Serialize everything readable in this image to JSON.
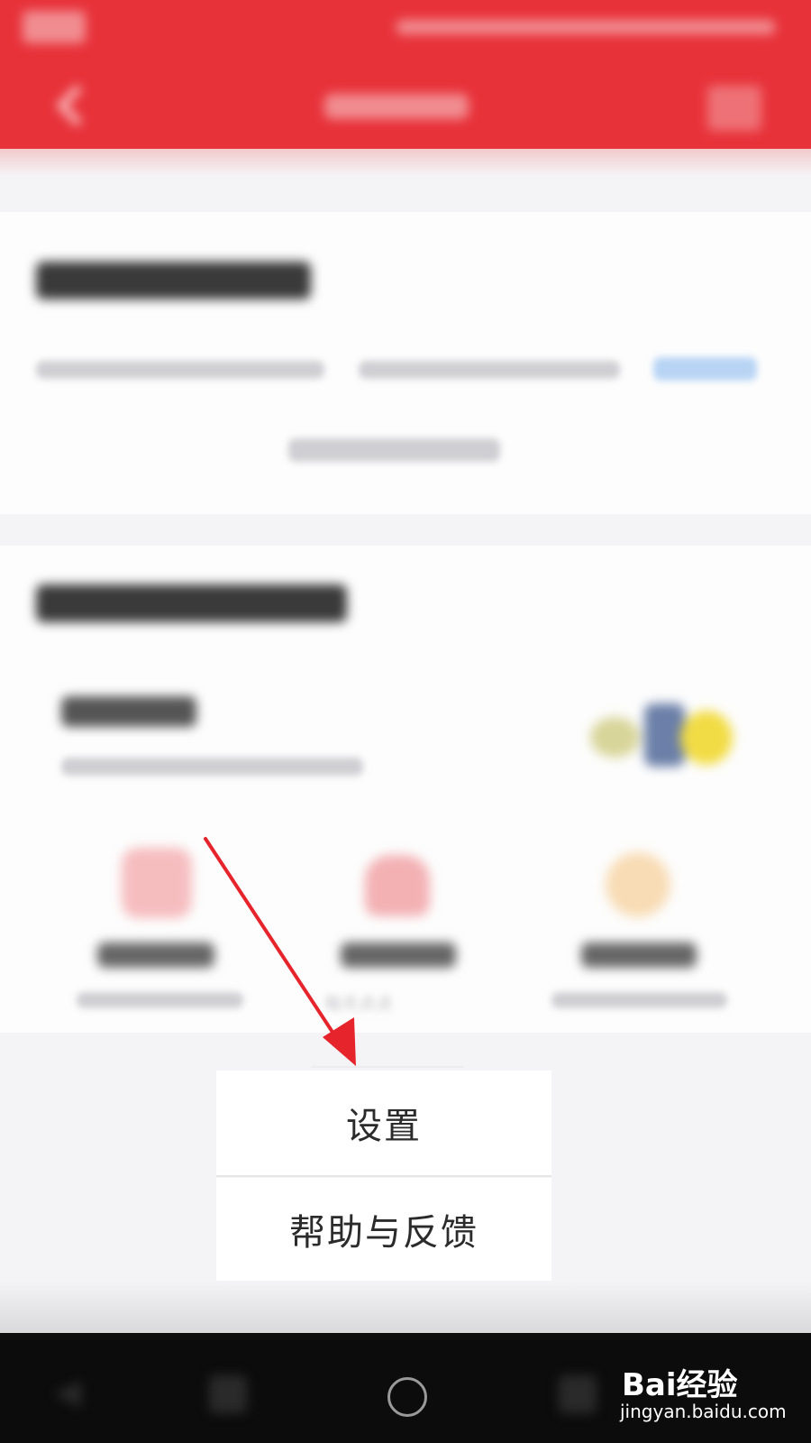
{
  "menu": {
    "items": [
      {
        "label": "设置"
      },
      {
        "label": "帮助与反馈"
      }
    ]
  },
  "partial_text": "每天点点",
  "watermark": {
    "brand": "Bai经验",
    "url": "jingyan.baidu.com"
  },
  "colors": {
    "header_bg": "#e8323a",
    "arrow": "#e6242b",
    "menu_bg": "#ffffff",
    "navbar_bg": "#0c0c0c"
  },
  "icons": {
    "back": "back-arrow-icon",
    "more": "more-icon",
    "nav_back": "nav-back-icon",
    "nav_home": "nav-home-icon",
    "nav_recent": "nav-recent-icon"
  }
}
